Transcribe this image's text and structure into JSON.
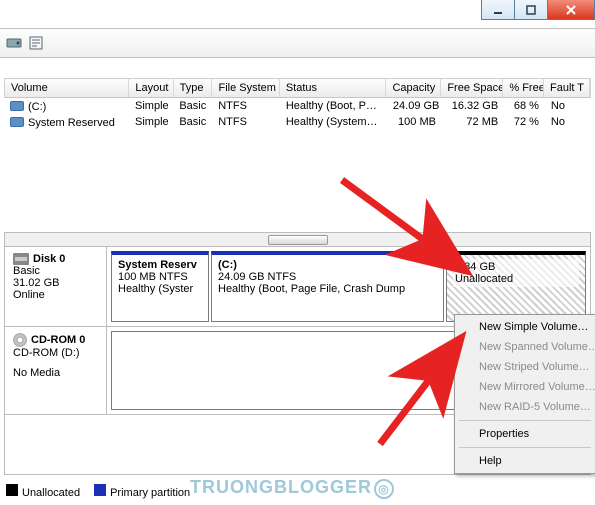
{
  "titlebar": {
    "minimize": "minimize",
    "maximize": "maximize",
    "close": "close"
  },
  "columns": {
    "volume": "Volume",
    "layout": "Layout",
    "type": "Type",
    "filesystem": "File System",
    "status": "Status",
    "capacity": "Capacity",
    "freespace": "Free Space",
    "pctfree": "% Free",
    "fault": "Fault T"
  },
  "volumes": [
    {
      "name": "(C:)",
      "layout": "Simple",
      "type": "Basic",
      "filesystem": "NTFS",
      "status": "Healthy (Boot, P…",
      "capacity": "24.09 GB",
      "freespace": "16.32 GB",
      "pctfree": "68 %",
      "fault": "No"
    },
    {
      "name": "System Reserved",
      "layout": "Simple",
      "type": "Basic",
      "filesystem": "NTFS",
      "status": "Healthy (System…",
      "capacity": "100 MB",
      "freespace": "72 MB",
      "pctfree": "72 %",
      "fault": "No"
    }
  ],
  "disk0": {
    "label": "Disk 0",
    "type": "Basic",
    "size": "31.02 GB",
    "state": "Online",
    "partitions": [
      {
        "name": "System Reserv",
        "line2": "100 MB NTFS",
        "line3": "Healthy (Syster"
      },
      {
        "name": "(C:)",
        "line2": "24.09 GB NTFS",
        "line3": "Healthy (Boot, Page File, Crash Dump"
      },
      {
        "size": "6.84 GB",
        "status": "Unallocated"
      }
    ]
  },
  "cdrom": {
    "label": "CD-ROM 0",
    "sub": "CD-ROM (D:)",
    "state": "No Media"
  },
  "legend": {
    "unallocated": "Unallocated",
    "primary": "Primary partition"
  },
  "context_menu": {
    "new_simple": "New Simple Volume…",
    "new_spanned": "New Spanned Volume…",
    "new_striped": "New Striped Volume…",
    "new_mirrored": "New Mirrored Volume…",
    "new_raid5": "New RAID-5 Volume…",
    "properties": "Properties",
    "help": "Help"
  },
  "watermark": "TRUONGBLOGGER"
}
